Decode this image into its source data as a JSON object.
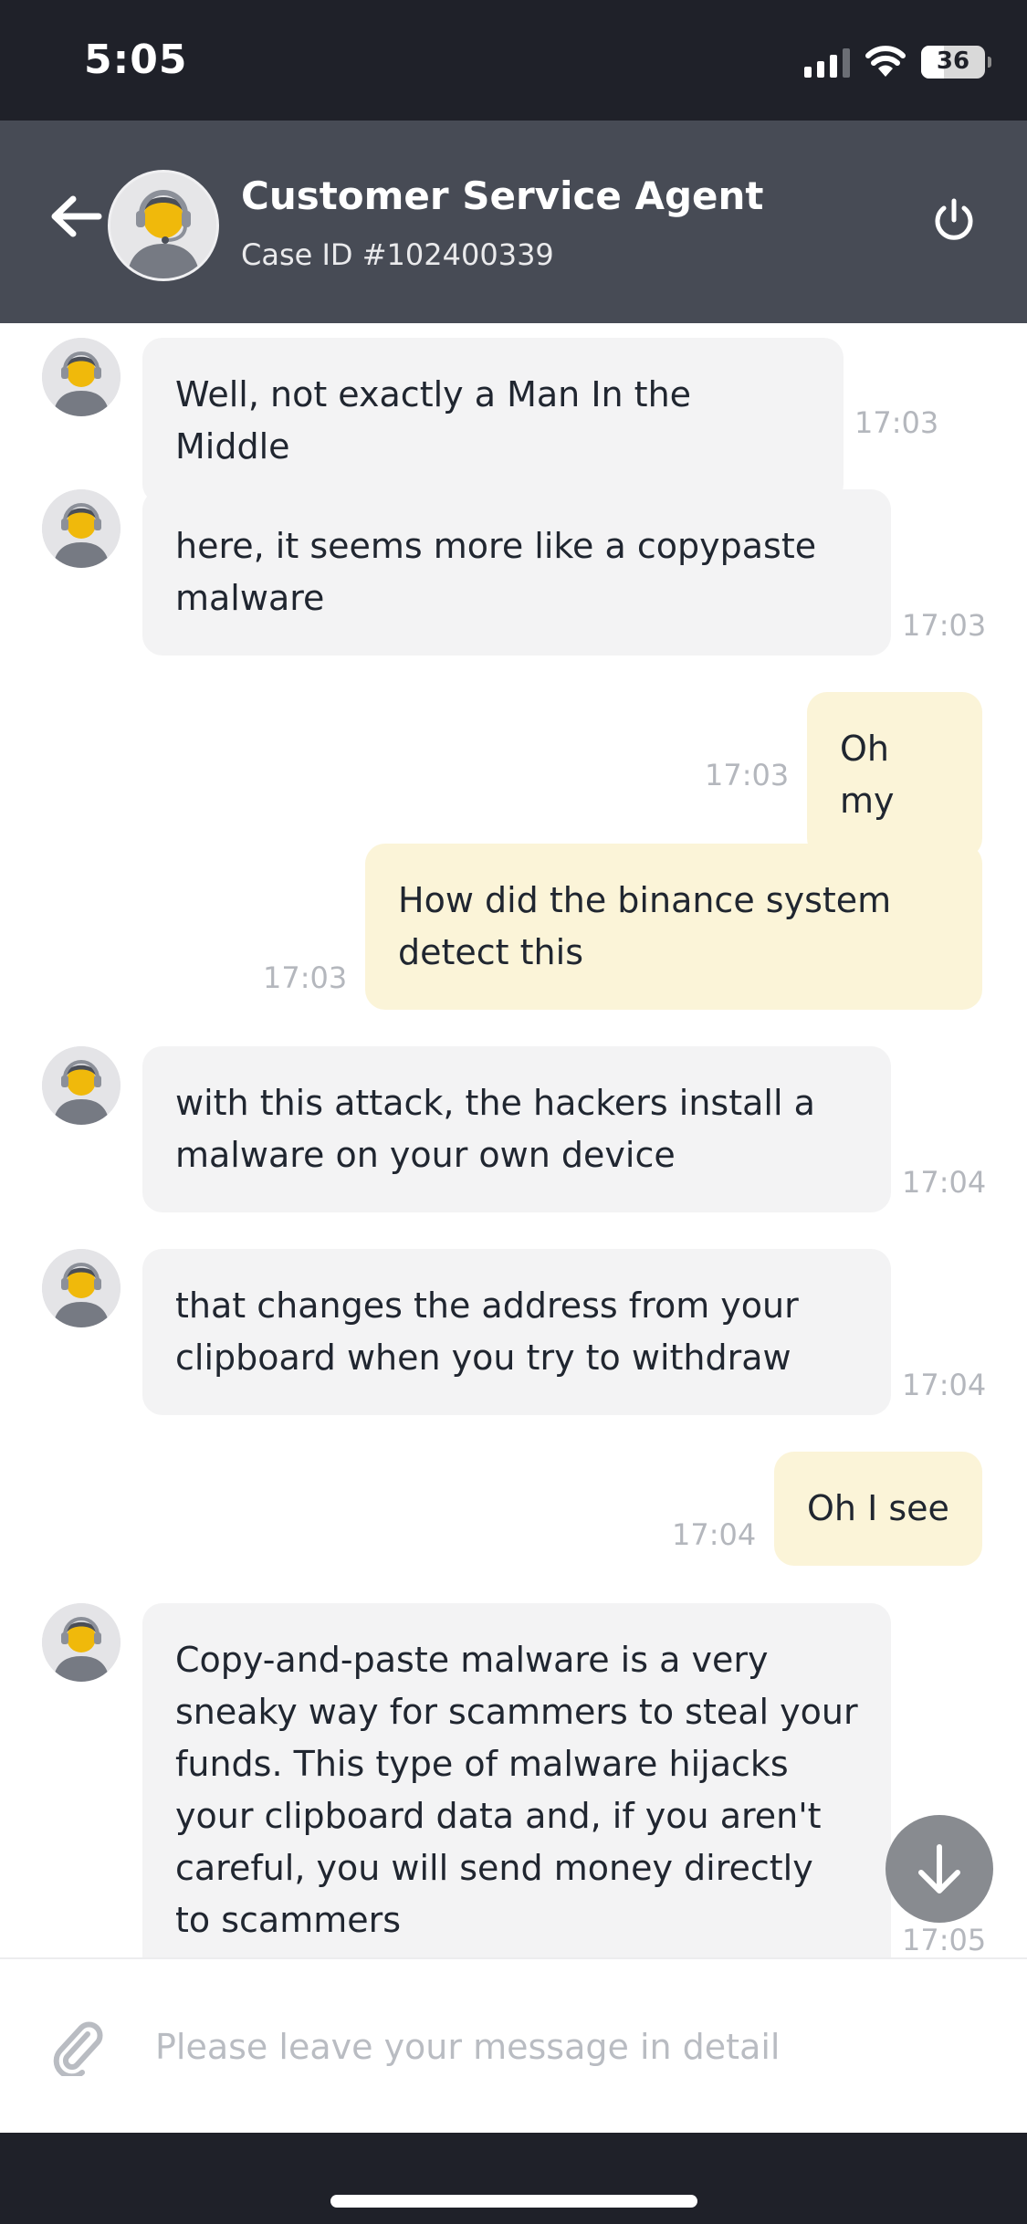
{
  "status_bar": {
    "time": "5:05",
    "battery": "36",
    "battery_level": 0.36,
    "icons": [
      "signal-icon",
      "wifi-icon",
      "battery-icon"
    ]
  },
  "header": {
    "title": "Customer Service Agent",
    "case_id": "Case ID #102400339",
    "icons": [
      "back-arrow-icon",
      "agent-avatar",
      "power-icon"
    ]
  },
  "messages": [
    {
      "from": "agent",
      "text": "Well, not exactly a Man In the Middle",
      "time": "17:03"
    },
    {
      "from": "agent",
      "text": "here, it seems more like a copypaste malware",
      "time": "17:03"
    },
    {
      "from": "user",
      "text": "Oh my",
      "time": "17:03"
    },
    {
      "from": "user",
      "text": "How did the binance system detect this",
      "time": "17:03"
    },
    {
      "from": "agent",
      "text": "with this attack, the hackers install a malware on your own device",
      "time": "17:04"
    },
    {
      "from": "agent",
      "text": "that changes the address from your clipboard when you try to withdraw",
      "time": "17:04"
    },
    {
      "from": "user",
      "text": "Oh I see",
      "time": "17:04"
    },
    {
      "from": "agent",
      "text": "Copy-and-paste malware is a very sneaky way for scammers to steal your funds. This type of malware hijacks your clipboard data and, if you aren't careful, you will send money directly to scammers",
      "time": "17:05"
    }
  ],
  "input": {
    "placeholder": "Please leave your message in detail",
    "value": ""
  },
  "colors": {
    "header_bg": "#474b55",
    "status_bg": "#1f2129",
    "agent_bubble": "#f3f3f4",
    "user_bubble": "#fbf4d8",
    "accent": "#f0b90b"
  }
}
